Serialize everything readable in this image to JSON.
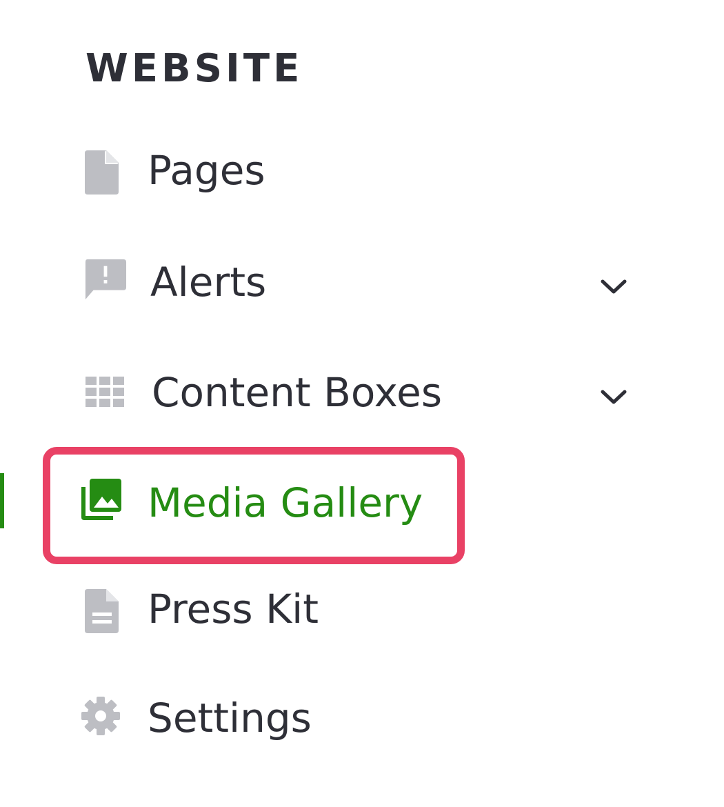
{
  "section": {
    "title": "WEBSITE"
  },
  "colors": {
    "text": "#2e2f37",
    "icon": "#bdbec3",
    "active": "#258c13",
    "highlight": "#e94165"
  },
  "nav": {
    "items": [
      {
        "label": "Pages",
        "icon": "file-icon",
        "expandable": false,
        "active": false
      },
      {
        "label": "Alerts",
        "icon": "alert-comment-icon",
        "expandable": true,
        "active": false
      },
      {
        "label": "Content Boxes",
        "icon": "grid-icon",
        "expandable": true,
        "active": false
      },
      {
        "label": "Media Gallery",
        "icon": "image-library-icon",
        "expandable": false,
        "active": true
      },
      {
        "label": "Press Kit",
        "icon": "document-icon",
        "expandable": false,
        "active": false
      },
      {
        "label": "Settings",
        "icon": "gear-icon",
        "expandable": false,
        "active": false
      }
    ]
  }
}
